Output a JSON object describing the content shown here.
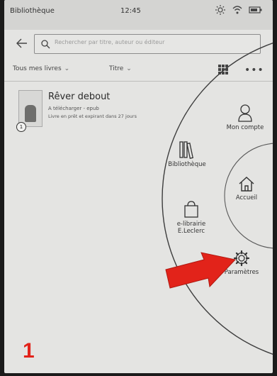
{
  "status_bar": {
    "title": "Bibliothèque",
    "time": "12:45"
  },
  "search": {
    "placeholder": "Rechercher par titre, auteur ou éditeur"
  },
  "filters": {
    "all_books": "Tous mes livres",
    "sort": "Titre"
  },
  "book": {
    "title": "Rêver debout",
    "format": "A télécharger - epub",
    "loan": "Livre en prêt et expirant dans 27 jours",
    "badge": "1"
  },
  "menu": {
    "account": "Mon compte",
    "library": "Bibliothèque",
    "home": "Accueil",
    "store_line1": "e-librairie",
    "store_line2": "E.Leclerc",
    "settings": "Paramètres"
  },
  "annotation": {
    "step_number": "1",
    "color": "#e2231a"
  },
  "icons": [
    "back-arrow-icon",
    "search-icon",
    "brightness-icon",
    "wifi-icon",
    "battery-icon",
    "grid-view-icon",
    "more-icon",
    "account-icon",
    "library-icon",
    "home-icon",
    "shopping-bag-icon",
    "gear-icon"
  ]
}
